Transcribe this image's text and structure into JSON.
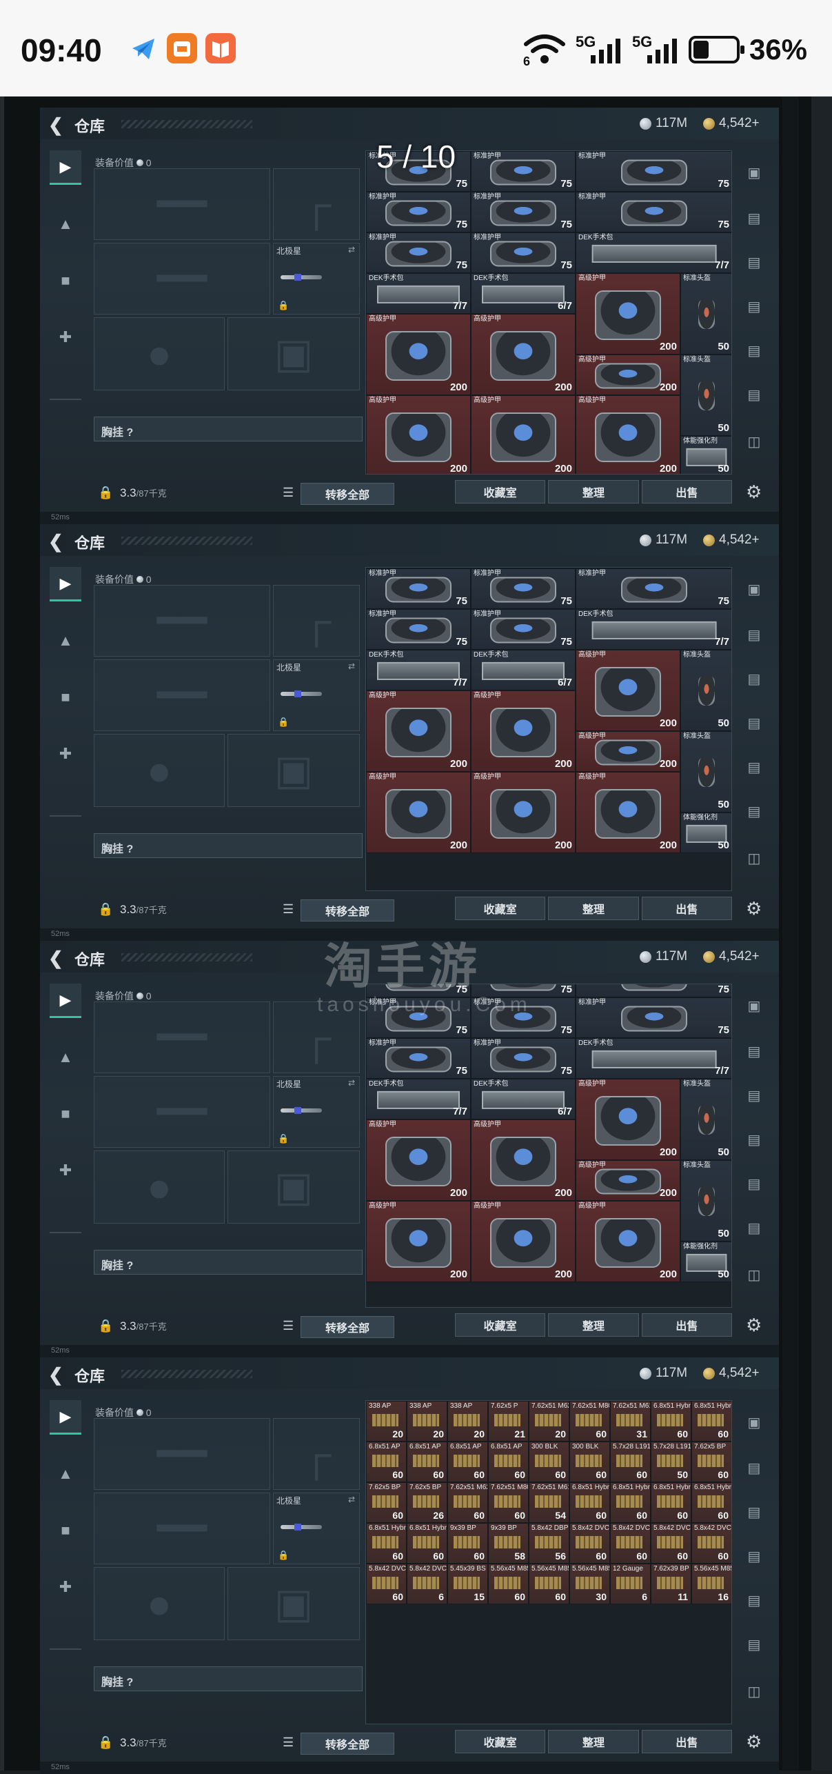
{
  "status_bar": {
    "time": "09:40",
    "network_1": "5G",
    "network_2": "5G",
    "wifi_label": "6",
    "battery": "36%"
  },
  "viewer": {
    "page_counter": "5 / 10",
    "watermark_cn": "淘手游",
    "watermark_en": "taoshouyou.Com"
  },
  "panel": {
    "back_icon": "chevron-left-icon",
    "title": "仓库",
    "currency_silver": "117M",
    "currency_gold": "4,542+",
    "equip_value_label": "装备价值",
    "equip_value": "0",
    "knife_name": "北极星",
    "chest_label": "胸挂",
    "chest_help": "?",
    "weight_current": "3.3",
    "weight_max": "/87千克",
    "transfer_all": "转移全部",
    "btn_collection": "收藏室",
    "btn_sort": "整理",
    "btn_sell": "出售",
    "ping": "52ms"
  },
  "armor_items": {
    "standard_armor": "标准护甲",
    "standard_helmet": "标准头盔",
    "dek_kit": "DEK手术包",
    "advanced_armor": "高级护甲",
    "strength_injector": "体能强化剂",
    "v75": "75",
    "v77": "7/7",
    "v67": "6/7",
    "v200": "200",
    "v50": "50"
  },
  "ammo_items": [
    {
      "name": "338 AP",
      "qty": "20"
    },
    {
      "name": "338 AP",
      "qty": "20"
    },
    {
      "name": "338 AP",
      "qty": "20"
    },
    {
      "name": "7.62x5 P",
      "qty": "21"
    },
    {
      "name": "7.62x51 M62",
      "qty": "20"
    },
    {
      "name": "7.62x51 M80",
      "qty": "60"
    },
    {
      "name": "7.62x51 M61",
      "qty": "31"
    },
    {
      "name": "6.8x51 Hybrid",
      "qty": "60"
    },
    {
      "name": "6.8x51 Hybrid",
      "qty": "60"
    },
    {
      "name": "6.8x51 AP",
      "qty": "60"
    },
    {
      "name": "6.8x51 AP",
      "qty": "60"
    },
    {
      "name": "6.8x51 AP",
      "qty": "60"
    },
    {
      "name": "6.8x51 AP",
      "qty": "60"
    },
    {
      "name": "300 BLK",
      "qty": "60"
    },
    {
      "name": "300 BLK",
      "qty": "60"
    },
    {
      "name": "5.7x28 L191",
      "qty": "60"
    },
    {
      "name": "5.7x28 L191",
      "qty": "50"
    },
    {
      "name": "7.62x5 BP",
      "qty": "60"
    },
    {
      "name": "7.62x5 BP",
      "qty": "60"
    },
    {
      "name": "7.62x5 BP",
      "qty": "26"
    },
    {
      "name": "7.62x51 M62",
      "qty": "60"
    },
    {
      "name": "7.62x51 M80",
      "qty": "60"
    },
    {
      "name": "7.62x51 M61",
      "qty": "54"
    },
    {
      "name": "6.8x51 Hybrid",
      "qty": "60"
    },
    {
      "name": "6.8x51 Hybrid",
      "qty": "60"
    },
    {
      "name": "6.8x51 Hybrid",
      "qty": "60"
    },
    {
      "name": "6.8x51 Hybrid",
      "qty": "60"
    },
    {
      "name": "6.8x51 Hybrid",
      "qty": "60"
    },
    {
      "name": "6.8x51 Hybrid",
      "qty": "60"
    },
    {
      "name": "9x39 BP",
      "qty": "60"
    },
    {
      "name": "9x39 BP",
      "qty": "58"
    },
    {
      "name": "5.8x42 DBP10",
      "qty": "56"
    },
    {
      "name": "5.8x42 DVC12",
      "qty": "60"
    },
    {
      "name": "5.8x42 DVC12",
      "qty": "60"
    },
    {
      "name": "5.8x42 DVC12",
      "qty": "60"
    },
    {
      "name": "5.8x42 DVC12",
      "qty": "60"
    },
    {
      "name": "5.8x42 DVC12",
      "qty": "60"
    },
    {
      "name": "5.8x42 DVC12",
      "qty": "6"
    },
    {
      "name": "5.45x39 BS",
      "qty": "15"
    },
    {
      "name": "5.56x45 M855",
      "qty": "60"
    },
    {
      "name": "5.56x45 M855",
      "qty": "60"
    },
    {
      "name": "5.56x45 M855",
      "qty": "30"
    },
    {
      "name": "12 Gauge",
      "qty": "6"
    },
    {
      "name": "7.62x39 BP",
      "qty": "11"
    },
    {
      "name": "5.56x45 M855",
      "qty": "16"
    }
  ]
}
